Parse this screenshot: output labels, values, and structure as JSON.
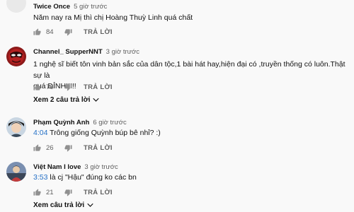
{
  "comments": [
    {
      "author": "Twice Once",
      "time": "5 giờ trước",
      "text": "Năm nay ra Mị thì chị Hoàng Thuỳ Linh quá chất",
      "likes": "84",
      "reply_label": "TRẢ LỜI"
    },
    {
      "author": "Channel_ SupperNNT",
      "time": "3 giờ trước",
      "text_line1": "1 nghệ sĩ biết tôn vinh bản sắc của dân tộc,1 bài hát hay,hiện đại có ,truyền thống có luôn.Thật sự là",
      "text_line2": "quá ĐỈNH!!!!!",
      "likes": "76",
      "reply_label": "TRẢ LỜI",
      "replies_label": "Xem 2 câu trả lời"
    },
    {
      "author": "Phạm Quỳnh Anh",
      "time": "6 giờ trước",
      "timestamp": "4:04",
      "text": " Trông giống Quỳnh búp bê nhỉ? :)",
      "likes": "26",
      "reply_label": "TRẢ LỜI"
    },
    {
      "author": "Việt Nam I love",
      "time": "3 giờ trước",
      "timestamp": "3:53",
      "text": " là cj \"Hậu\" đúng ko các bn",
      "likes": "21",
      "reply_label": "TRẢ LỜI",
      "replies_label": "Xem câu trả lời"
    }
  ],
  "icons": {
    "like": "thumbs-up-icon",
    "dislike": "thumbs-down-icon",
    "expand": "chevron-down-icon"
  },
  "colors": {
    "background": "#f9f9f9",
    "timestamp_link": "#2470c6",
    "secondary_text": "#606060"
  }
}
